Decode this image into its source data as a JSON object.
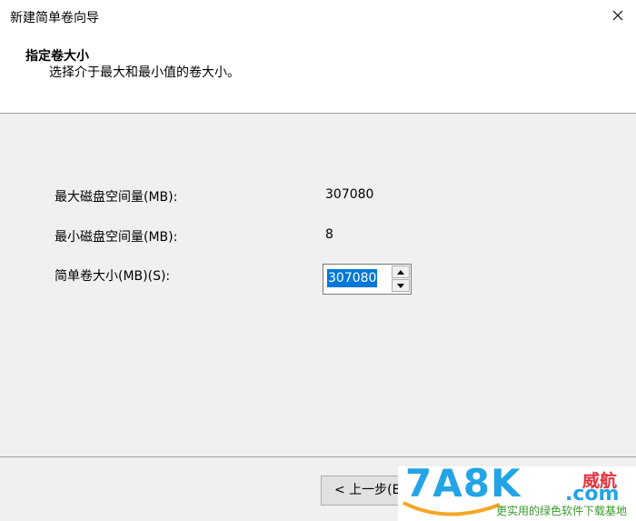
{
  "window": {
    "title": "新建简单卷向导"
  },
  "header": {
    "heading": "指定卷大小",
    "subheading": "选择介于最大和最小值的卷大小。"
  },
  "fields": {
    "max_label": "最大磁盘空间量(MB):",
    "max_value": "307080",
    "min_label": "最小磁盘空间量(MB):",
    "min_value": "8",
    "size_label": "简单卷大小(MB)(S):",
    "size_value": "307080"
  },
  "buttons": {
    "back_label": "< 上一步(B"
  },
  "watermark": {
    "logo": "7A8K",
    "suffix": ".com",
    "cn_name": "威航",
    "tagline": "更实用的绿色软件下载基地"
  },
  "colors": {
    "selection": "#0078d7",
    "accent": "#22a4e6"
  },
  "icons": {
    "close": "close-icon",
    "up": "spin-up-icon",
    "down": "spin-down-icon"
  }
}
